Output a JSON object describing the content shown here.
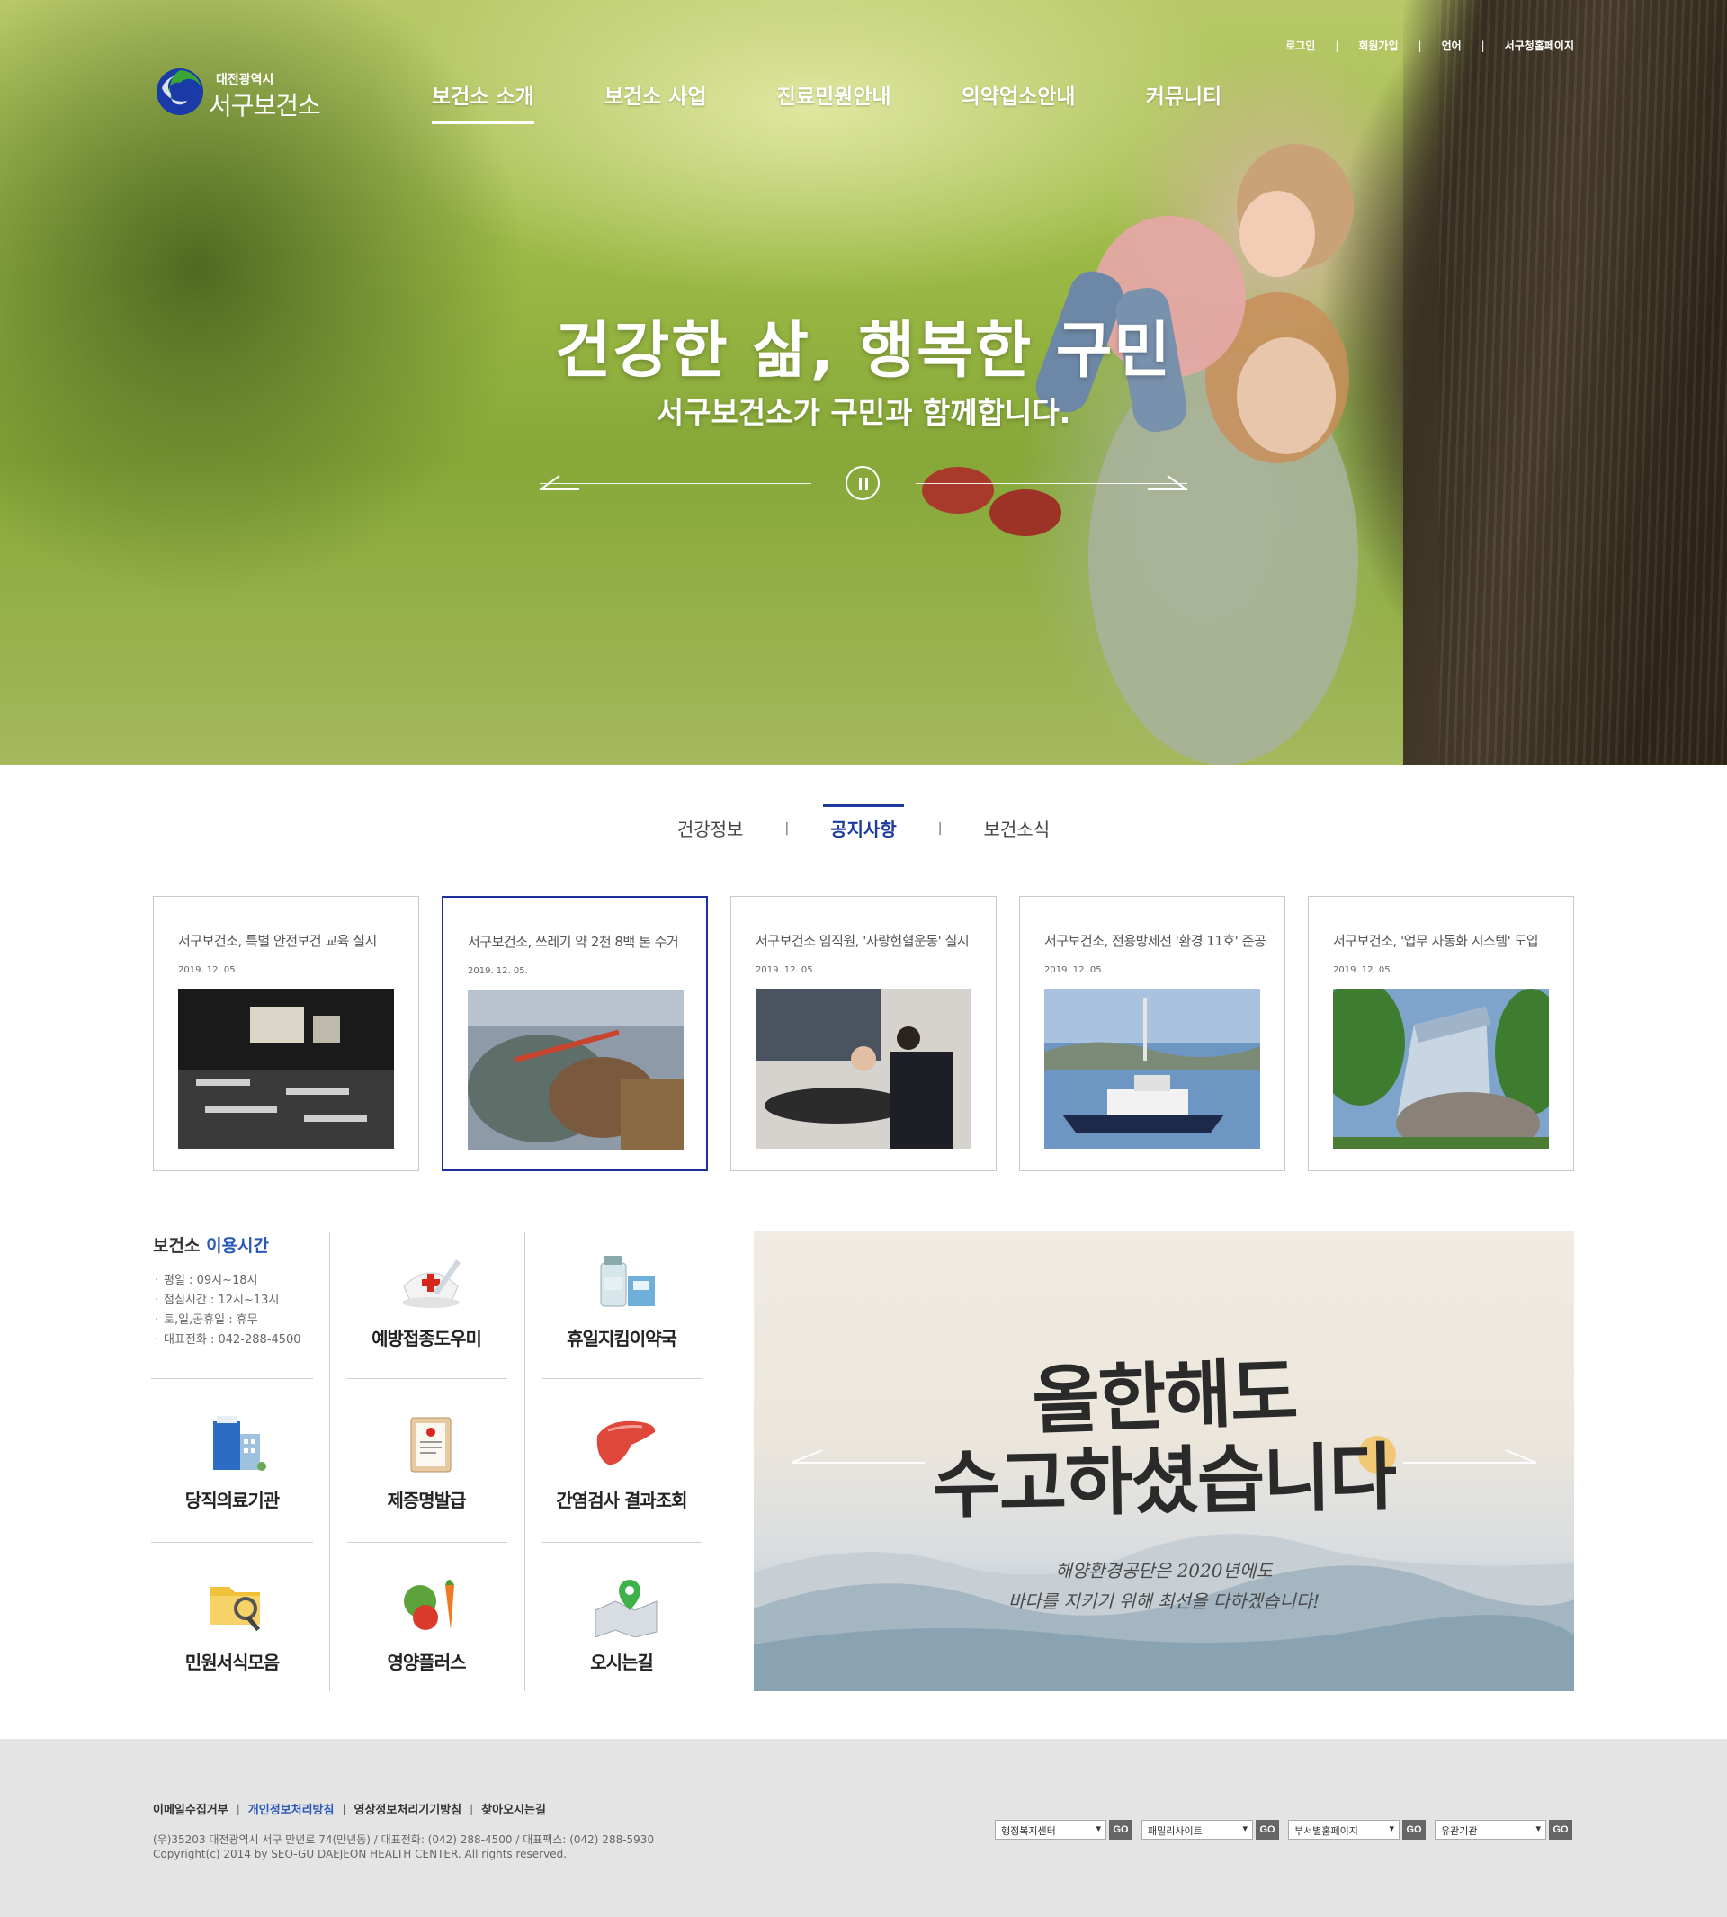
{
  "header": {
    "logo_small": "대전광역시",
    "logo_big": "서구보건소",
    "nav": [
      {
        "label": "보건소 소개",
        "active": true
      },
      {
        "label": "보건소 사업",
        "active": false
      },
      {
        "label": "진료민원안내",
        "active": false
      },
      {
        "label": "의약업소안내",
        "active": false
      },
      {
        "label": "커뮤니티",
        "active": false
      }
    ],
    "util": [
      "로그인",
      "회원가입",
      "언어",
      "서구청홈페이지"
    ]
  },
  "hero": {
    "title": "건강한 삶, 행복한 구민",
    "subtitle": "서구보건소가 구민과 함께합니다."
  },
  "tabs": [
    {
      "label": "건강정보",
      "active": false
    },
    {
      "label": "공지사항",
      "active": true
    },
    {
      "label": "보건소식",
      "active": false
    }
  ],
  "news": [
    {
      "title": "서구보건소, 특별 안전보건 교육 실시",
      "date": "2019. 12. 05."
    },
    {
      "title": "서구보건소, 쓰레기 약 2천 8백 톤 수거",
      "date": "2019. 12. 05."
    },
    {
      "title": "서구보건소 임직원, '사랑헌혈운동' 실시",
      "date": "2019. 12. 05."
    },
    {
      "title": "서구보건소, 전용방제선 '환경 11호' 준공",
      "date": "2019. 12. 05."
    },
    {
      "title": "서구보건소, '업무 자동화 시스템' 도입",
      "date": "2019. 12. 05."
    }
  ],
  "hours": {
    "title_main": "보건소",
    "title_accent": "이용시간",
    "items": [
      "평일 : 09시~18시",
      "점심시간 : 12시~13시",
      "토,일,공휴일 : 휴무",
      "대표전화 : 042-288-4500"
    ]
  },
  "quick": [
    {
      "label": "예방접종도우미",
      "icon": "vaccine-icon"
    },
    {
      "label": "휴일지킴이약국",
      "icon": "pharmacy-icon"
    },
    {
      "label": "당직의료기관",
      "icon": "hospital-icon"
    },
    {
      "label": "제증명발급",
      "icon": "certificate-icon"
    },
    {
      "label": "간염검사 결과조회",
      "icon": "liver-icon"
    },
    {
      "label": "민원서식모음",
      "icon": "folder-search-icon"
    },
    {
      "label": "영양플러스",
      "icon": "vegetables-icon"
    },
    {
      "label": "오시는길",
      "icon": "map-pin-icon"
    }
  ],
  "banner": {
    "line1": "올한해도",
    "line2": "수고하셨습니다",
    "sub1": "해양환경공단은 2020년에도",
    "sub2": "바다를 지키기 위해 최선을 다하겠습니다!"
  },
  "footer": {
    "links": [
      {
        "label": "이메일수집거부",
        "highlight": false
      },
      {
        "label": "개인정보처리방침",
        "highlight": true
      },
      {
        "label": "영상정보처리기기방침",
        "highlight": false
      },
      {
        "label": "찾아오시는길",
        "highlight": false
      }
    ],
    "address": "(우)35203 대전광역시 서구 만년로 74(만년동) / 대표전화: (042) 288-4500 / 대표팩스: (042) 288-5930",
    "copyright": "Copyright(c) 2014 by SEO-GU DAEJEON HEALTH CENTER. All rights reserved.",
    "selects": [
      "행정복지센터",
      "패밀리사이트",
      "부서별홈페이지",
      "유관기관"
    ],
    "go_label": "GO"
  },
  "colors": {
    "accent": "#1c3ba0",
    "link_blue": "#2a58b7",
    "footer_bg": "#e4e4e4"
  }
}
